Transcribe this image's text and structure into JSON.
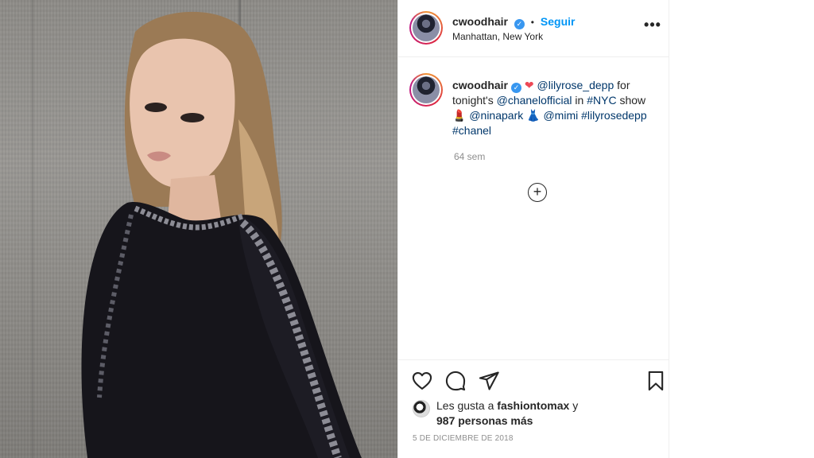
{
  "post": {
    "username": "cwoodhair",
    "follow_label": "Seguir",
    "separator": "•",
    "location": "Manhattan, New York",
    "more_label": "•••"
  },
  "caption": {
    "username": "cwoodhair",
    "heart": "❤",
    "mention1": "@lilyrose_depp",
    "text1": "for tonight's",
    "mention2": "@chanelofficial",
    "text2": "in",
    "hashtag1": "#NYC",
    "text3": "show",
    "emoji_lips": "💄",
    "mention3": "@ninapark",
    "emoji_dress": "👗",
    "mention4": "@mimi",
    "hashtag2": "#lilyrosedepp",
    "hashtag3": "#chanel",
    "time": "64 sem"
  },
  "load_more_label": "+",
  "likes": {
    "prefix": "Les gusta a",
    "user": "fashiontomax",
    "suffix": "y",
    "count_text": "987 personas más"
  },
  "date": "5 de diciembre de 2018",
  "icons": {
    "like": "heart-outline-icon",
    "comment": "comment-bubble-icon",
    "share": "paper-plane-icon",
    "save": "bookmark-icon"
  }
}
